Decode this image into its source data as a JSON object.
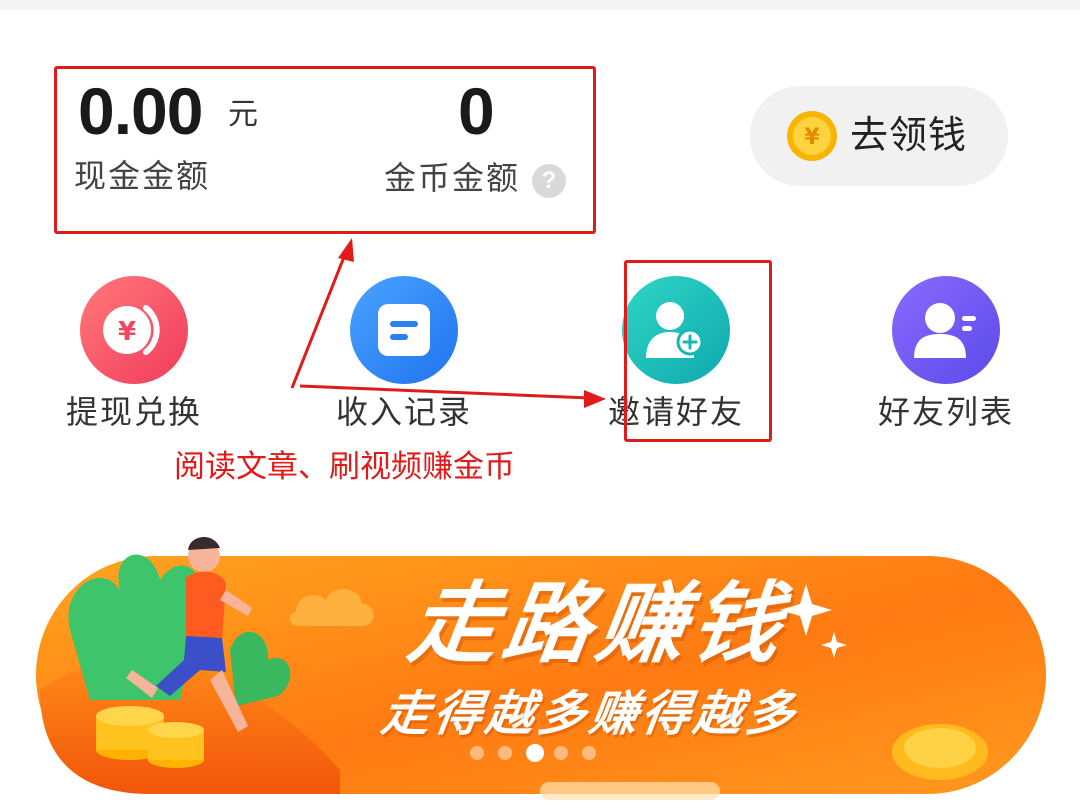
{
  "balance": {
    "cash_amount": "0.00",
    "cash_unit": "元",
    "cash_label": "现金金额",
    "coin_amount": "0",
    "coin_label": "金币金额",
    "help_icon_glyph": "?"
  },
  "claim_button": {
    "label": "去领钱",
    "icon": "gold-coin-icon",
    "coin_glyph": "¥"
  },
  "features": [
    {
      "label": "提现兑换",
      "icon": "yuan-exchange-icon",
      "color": "#f5576c"
    },
    {
      "label": "收入记录",
      "icon": "record-list-icon",
      "color": "#2f8af5"
    },
    {
      "label": "邀请好友",
      "icon": "add-friend-icon",
      "color": "#18c0b8"
    },
    {
      "label": "好友列表",
      "icon": "friend-list-icon",
      "color": "#6f5cf0"
    }
  ],
  "annotation": {
    "text": "阅读文章、刷视频赚金币",
    "color": "#e11a1a"
  },
  "banner": {
    "title": "走路赚钱",
    "subtitle": "走得越多赚得越多",
    "slide_count": 5,
    "active_slide": 2,
    "colors": {
      "orange_light": "#ffb02e",
      "orange_dark": "#ff6a10"
    }
  }
}
